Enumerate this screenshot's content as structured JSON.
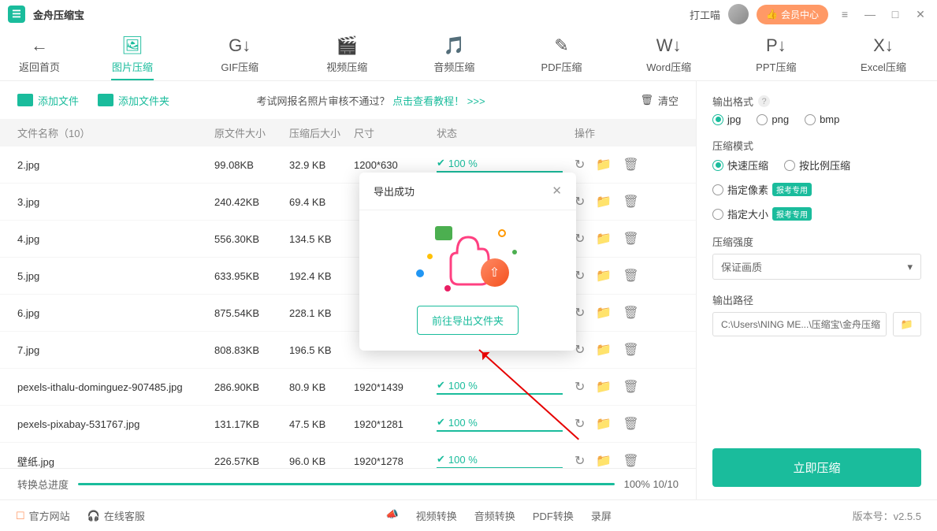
{
  "app": {
    "title": "金舟压缩宝",
    "user": "打工喵",
    "vip": "会员中心"
  },
  "tabs": {
    "back": "返回首页",
    "items": [
      "图片压缩",
      "GIF压缩",
      "视频压缩",
      "音频压缩",
      "PDF压缩",
      "Word压缩",
      "PPT压缩",
      "Excel压缩"
    ]
  },
  "toolbar": {
    "add_file": "添加文件",
    "add_folder": "添加文件夹",
    "tip_prefix": "考试网报名照片审核不通过？",
    "tip_link": "点击查看教程！",
    "clear": "清空"
  },
  "headers": {
    "name": "文件名称（10）",
    "orig": "原文件大小",
    "comp": "压缩后大小",
    "size": "尺寸",
    "status": "状态",
    "ops": "操作"
  },
  "rows": [
    {
      "name": "2.jpg",
      "orig": "99.08KB",
      "comp": "32.9 KB",
      "size": "1200*630",
      "status": "100 %"
    },
    {
      "name": "3.jpg",
      "orig": "240.42KB",
      "comp": "69.4 KB",
      "size": "",
      "status": ""
    },
    {
      "name": "4.jpg",
      "orig": "556.30KB",
      "comp": "134.5 KB",
      "size": "",
      "status": ""
    },
    {
      "name": "5.jpg",
      "orig": "633.95KB",
      "comp": "192.4 KB",
      "size": "",
      "status": ""
    },
    {
      "name": "6.jpg",
      "orig": "875.54KB",
      "comp": "228.1 KB",
      "size": "",
      "status": ""
    },
    {
      "name": "7.jpg",
      "orig": "808.83KB",
      "comp": "196.5 KB",
      "size": "",
      "status": ""
    },
    {
      "name": "pexels-ithalu-dominguez-907485.jpg",
      "orig": "286.90KB",
      "comp": "80.9 KB",
      "size": "1920*1439",
      "status": "100 %"
    },
    {
      "name": "pexels-pixabay-531767.jpg",
      "orig": "131.17KB",
      "comp": "47.5 KB",
      "size": "1920*1281",
      "status": "100 %"
    },
    {
      "name": "壁纸.jpg",
      "orig": "226.57KB",
      "comp": "96.0 KB",
      "size": "1920*1278",
      "status": "100 %"
    }
  ],
  "progress": {
    "label": "转换总进度",
    "text": "100% 10/10"
  },
  "right": {
    "output_format": "输出格式",
    "formats": [
      "jpg",
      "png",
      "bmp"
    ],
    "compress_mode": "压缩模式",
    "mode_fast": "快速压缩",
    "mode_ratio": "按比例压缩",
    "mode_pixel": "指定像素",
    "mode_size": "指定大小",
    "badge": "报考专用",
    "strength": "压缩强度",
    "strength_val": "保证画质",
    "out_path": "输出路径",
    "path": "C:\\Users\\NING ME...\\压缩宝\\金舟压缩",
    "go": "立即压缩"
  },
  "bottom": {
    "site": "官方网站",
    "support": "在线客服",
    "center": [
      "视频转换",
      "音频转换",
      "PDF转换",
      "录屏"
    ],
    "version": "版本号：v2.5.5"
  },
  "modal": {
    "title": "导出成功",
    "button": "前往导出文件夹"
  },
  "chevrons": ">>>"
}
